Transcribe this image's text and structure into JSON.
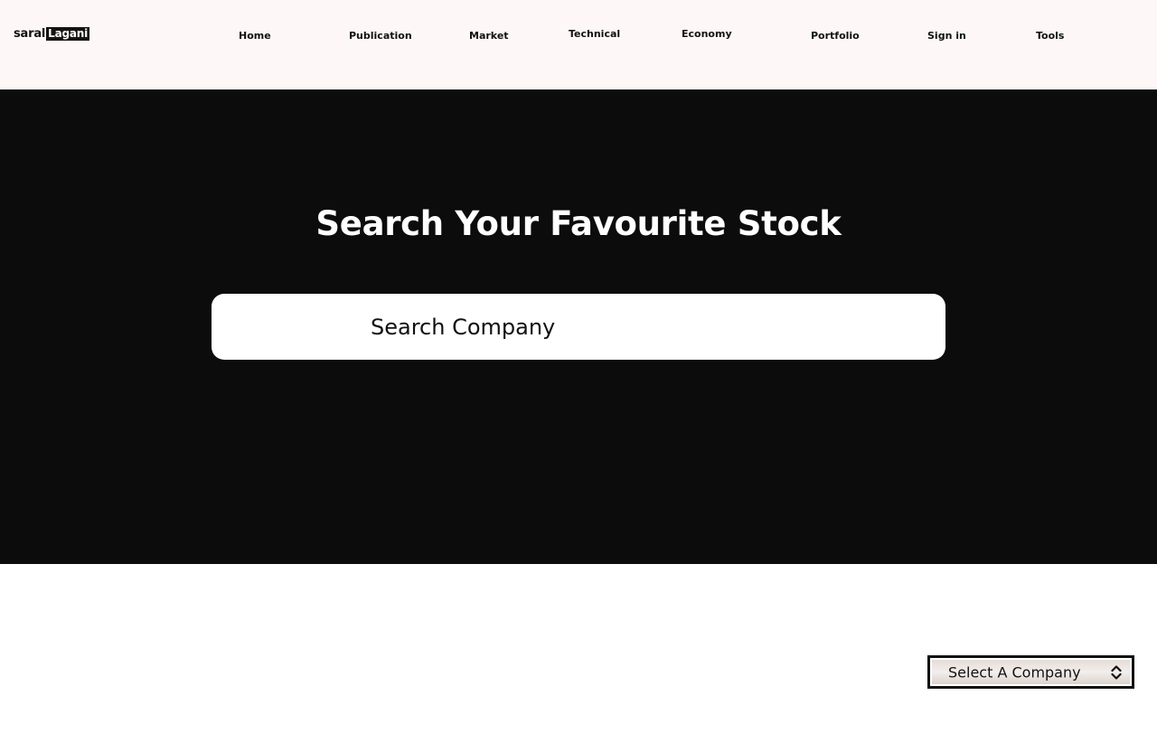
{
  "brand": {
    "part1": "saral",
    "part2": "Lagani"
  },
  "nav": {
    "home": "Home",
    "publication": "Publication",
    "market": "Market",
    "technical": "Technical",
    "economy": "Economy",
    "portfolio": "Portfolio",
    "sign_in": "Sign in",
    "tools": "Tools"
  },
  "hero": {
    "title": "Search Your Favourite Stock",
    "search_placeholder": "Search Company"
  },
  "company_select": {
    "selected": "Select A Company"
  },
  "colors": {
    "nav_background": "#fdf8f7",
    "hero_background": "#0c0c0c",
    "text_dark": "#111111",
    "text_light": "#ffffff"
  },
  "icons": {
    "select_arrows": "chevron-up-down-icon"
  }
}
